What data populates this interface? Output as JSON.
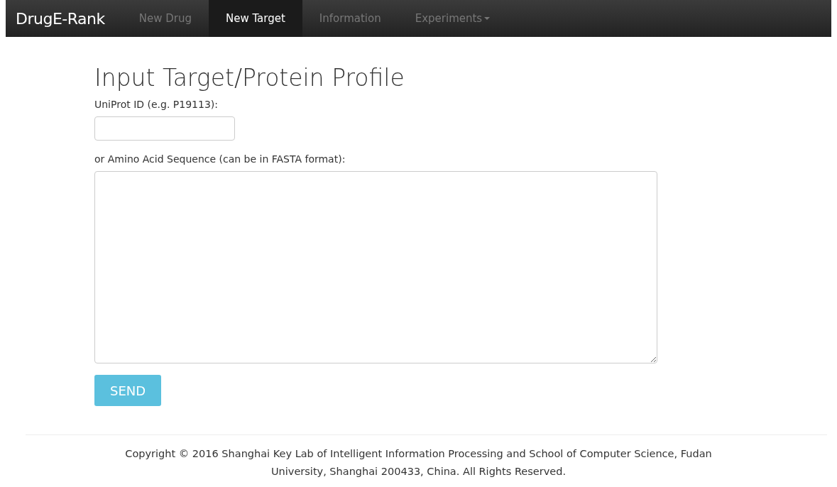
{
  "navbar": {
    "brand": "DrugE-Rank",
    "items": [
      {
        "label": "New Drug",
        "selected": false,
        "dropdown": false
      },
      {
        "label": "New Target",
        "selected": true,
        "dropdown": false
      },
      {
        "label": "Information",
        "selected": false,
        "dropdown": false
      },
      {
        "label": "Experiments",
        "selected": false,
        "dropdown": true
      }
    ]
  },
  "form": {
    "title": "Input Target/Protein Profile",
    "uniprot_label": "UniProt ID (e.g. P19113):",
    "sequence_label": "or Amino Acid Sequence (can be in FASTA format):",
    "submit": "SEND"
  },
  "footer": {
    "copyright": "Copyright © 2016 Shanghai Key Lab of Intelligent Information Processing and School of Computer Science, Fudan\nUniversity, Shanghai 200433, China. All Rights Reserved."
  }
}
